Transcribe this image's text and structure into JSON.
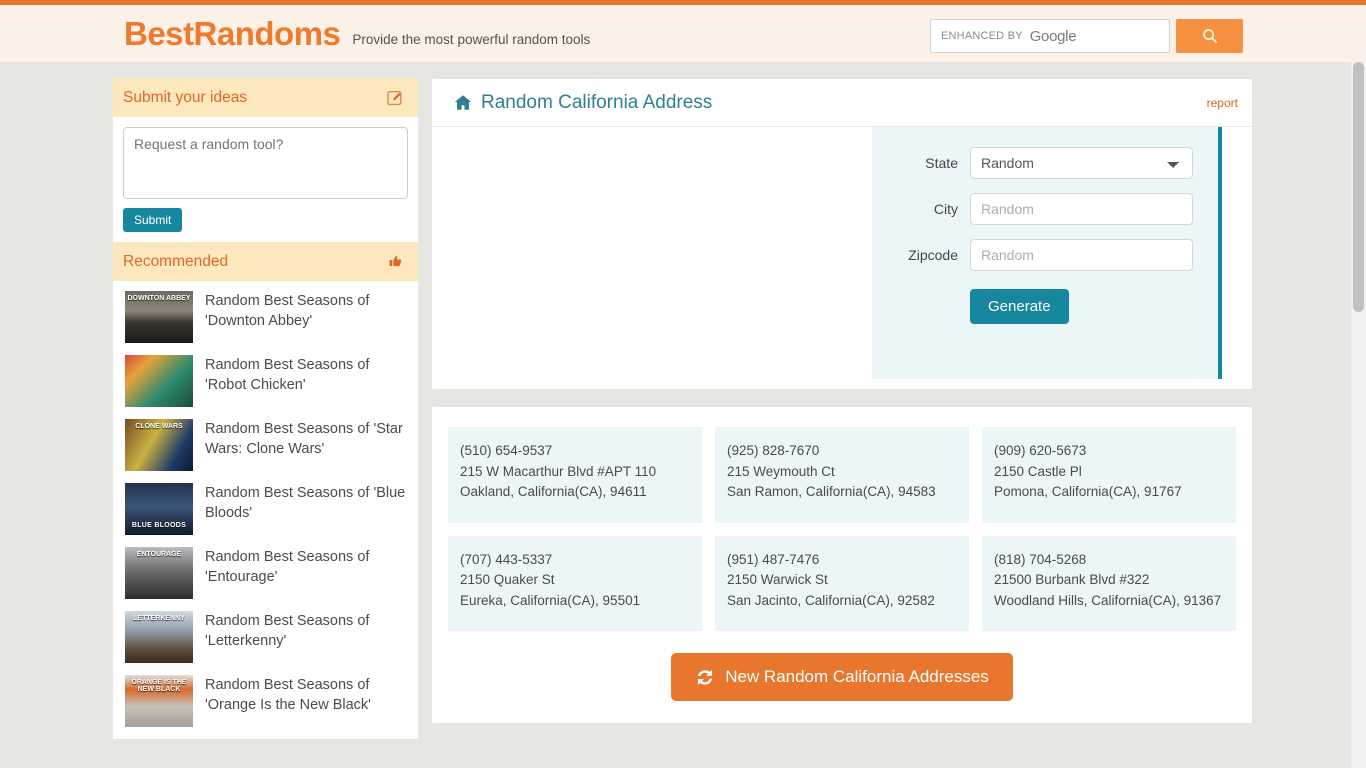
{
  "header": {
    "brand_part1": "Best",
    "brand_part2": "Randoms",
    "tagline": "Provide the most powerful random tools",
    "search": {
      "enhanced_label": "ENHANCED BY",
      "provider": "Google",
      "icon": "search-icon",
      "button_label": ""
    },
    "accent_color": "#e8762c"
  },
  "sidebar": {
    "submit_panel": {
      "title": "Submit your ideas",
      "icon": "edit-pencil-icon",
      "textarea_placeholder": "Request a random tool?",
      "textarea_value": "",
      "submit_label": "Submit"
    },
    "recommended_panel": {
      "title": "Recommended",
      "icon": "thumbs-up-icon"
    },
    "recommended_items": [
      {
        "label": "Random Best Seasons of 'Downton Abbey'",
        "thumb_class": "t-downton",
        "thumb_caption": "DOWNTON ABBEY",
        "thumb_caption_pos": "top"
      },
      {
        "label": "Random Best Seasons of 'Robot Chicken'",
        "thumb_class": "t-robot",
        "thumb_caption": "",
        "thumb_caption_pos": "bottom"
      },
      {
        "label": "Random Best Seasons of 'Star Wars: Clone Wars'",
        "thumb_class": "t-clone",
        "thumb_caption": "CLONE WARS",
        "thumb_caption_pos": "top"
      },
      {
        "label": "Random Best Seasons of 'Blue Bloods'",
        "thumb_class": "t-blue",
        "thumb_caption": "BLUE BLOODS",
        "thumb_caption_pos": "bottom"
      },
      {
        "label": "Random Best Seasons of 'Entourage'",
        "thumb_class": "t-ent",
        "thumb_caption": "ENTOURAGE",
        "thumb_caption_pos": "top"
      },
      {
        "label": "Random Best Seasons of 'Letterkenny'",
        "thumb_class": "t-letter",
        "thumb_caption": "LETTERKENNY",
        "thumb_caption_pos": "top"
      },
      {
        "label": "Random Best Seasons of 'Orange Is the New Black'",
        "thumb_class": "t-orange",
        "thumb_caption": "ORANGE IS THE NEW BLACK",
        "thumb_caption_pos": "top"
      }
    ]
  },
  "main": {
    "title": "Random California Address",
    "title_icon": "home-icon",
    "report_label": "report",
    "form": {
      "state_label": "State",
      "state_value": "Random",
      "state_options": [
        "Random"
      ],
      "city_label": "City",
      "city_value": "",
      "city_placeholder": "Random",
      "zipcode_label": "Zipcode",
      "zipcode_value": "",
      "zipcode_placeholder": "Random",
      "generate_label": "Generate",
      "accent_color": "#1787a0"
    },
    "results": [
      {
        "phone": "(510) 654-9537",
        "street": "215 W Macarthur Blvd #APT 110",
        "citystate": "Oakland, California(CA), 94611"
      },
      {
        "phone": "(925) 828-7670",
        "street": "215 Weymouth Ct",
        "citystate": "San Ramon, California(CA), 94583"
      },
      {
        "phone": "(909) 620-5673",
        "street": "2150 Castle Pl",
        "citystate": "Pomona, California(CA), 91767"
      },
      {
        "phone": "(707) 443-5337",
        "street": "2150 Quaker St",
        "citystate": "Eureka, California(CA), 95501"
      },
      {
        "phone": "(951) 487-7476",
        "street": "2150 Warwick St",
        "citystate": "San Jacinto, California(CA), 92582"
      },
      {
        "phone": "(818) 704-5268",
        "street": "21500 Burbank Blvd #322",
        "citystate": "Woodland Hills, California(CA), 91367"
      }
    ],
    "new_button": {
      "label": "New Random California Addresses",
      "icon": "refresh-icon",
      "color": "#e8762c"
    }
  }
}
